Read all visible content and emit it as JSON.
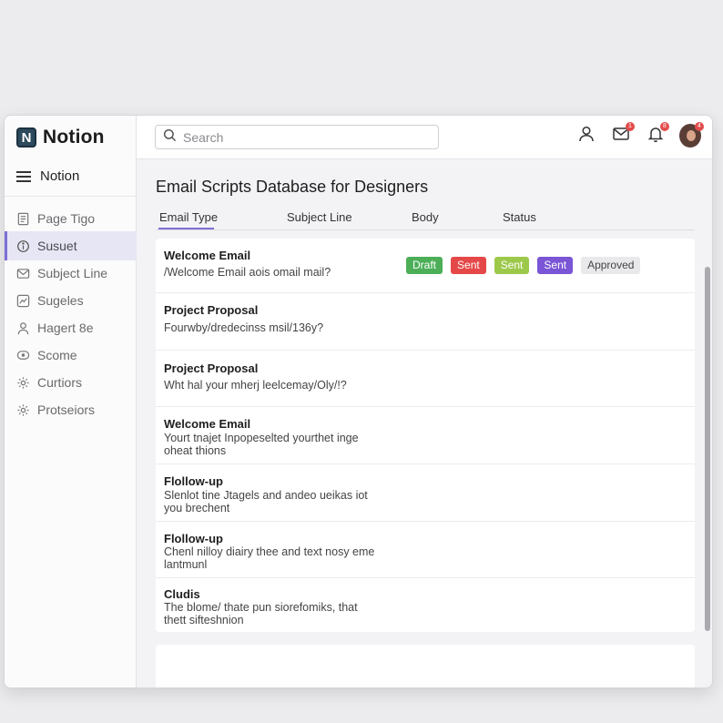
{
  "app": {
    "logo_letter": "N",
    "name": "Notion"
  },
  "sidebar": {
    "workspace_label": "Notion",
    "items": [
      {
        "label": "Page Tigo",
        "icon": "page-icon",
        "active": false
      },
      {
        "label": "Susuet",
        "icon": "info-icon",
        "active": true
      },
      {
        "label": "Subject Line",
        "icon": "mail-icon",
        "active": false
      },
      {
        "label": "Sugeles",
        "icon": "trend-icon",
        "active": false
      },
      {
        "label": "Hagert 8e",
        "icon": "person-icon",
        "active": false
      },
      {
        "label": "Scome",
        "icon": "chat-icon",
        "active": false
      },
      {
        "label": "Curtiors",
        "icon": "gear-icon",
        "active": false
      },
      {
        "label": "Protseiors",
        "icon": "gear-icon",
        "active": false
      }
    ]
  },
  "topbar": {
    "search_placeholder": "Search",
    "badges": {
      "mail": "1",
      "bell": "8",
      "avatar": "4"
    }
  },
  "database": {
    "title": "Email Scripts Database for Designers",
    "columns": [
      "Email Type",
      "Subject Line",
      "Body",
      "Status"
    ],
    "rows": [
      {
        "title": "Welcome Email",
        "body": "/Welcome Email aois omail mail?"
      },
      {
        "title": "Project Proposal",
        "body": "Fourwby/dredecinss msil/136y?"
      },
      {
        "title": "Project Proposal",
        "body": "Wht hal your mherj leelcemay/Oly/!?"
      },
      {
        "title": "Welcome Email",
        "body": "Yourt tnajet Inpopeselted yourthet inge oheat thions"
      },
      {
        "title": "Flollow-up",
        "body": "Slenlot tine Jtagels and andeo ueikas iot you brechent"
      },
      {
        "title": "Flollow-up",
        "body": "Chenl nilloy diairy thee and text nosy eme lantmunl"
      },
      {
        "title": "Cludis",
        "body": "The blome/ thate pun siorefomiks, that thett sifteshnion"
      }
    ],
    "status_tags": [
      {
        "label": "Draft",
        "color": "#4caf58"
      },
      {
        "label": "Sent",
        "color": "#e54848"
      },
      {
        "label": "Sent",
        "color": "#9dc94b"
      },
      {
        "label": "Sent",
        "color": "#7a55d6"
      },
      {
        "label": "Approved",
        "color": "#e9e9ec"
      }
    ]
  },
  "colors": {
    "accent": "#7c6fd6",
    "active_bg": "#e7e6f4"
  }
}
